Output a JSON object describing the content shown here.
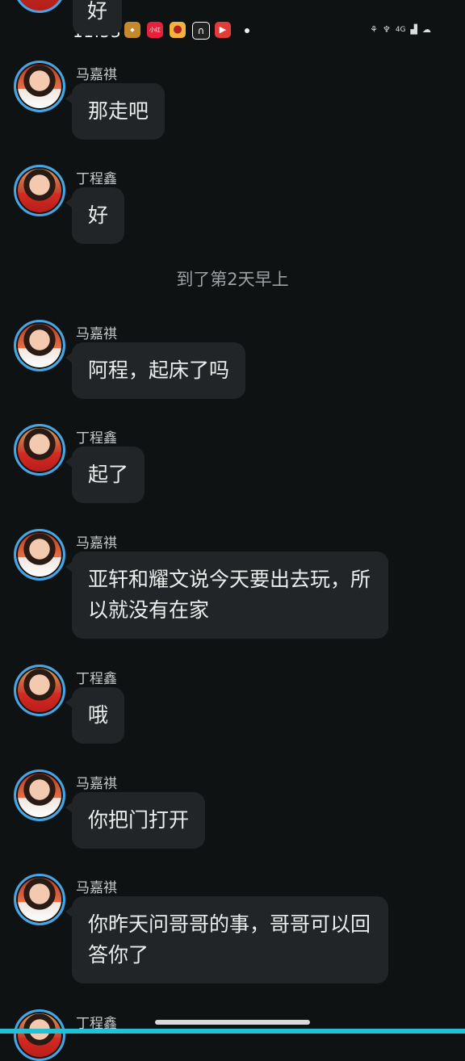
{
  "status_bar": {
    "time": "11:53",
    "app_icons": [
      {
        "name": "game-app-icon",
        "color": "#c4882d",
        "label": ""
      },
      {
        "name": "xiaohongshu-icon",
        "color": "#e8203a",
        "label": "小红书"
      },
      {
        "name": "weibo-icon",
        "color": "#f4b23e",
        "label": ""
      },
      {
        "name": "headset-app-icon",
        "color": "#222222",
        "label": ""
      },
      {
        "name": "video-app-icon",
        "color": "#e33b38",
        "label": ""
      }
    ],
    "right_indicators": [
      "4G"
    ]
  },
  "top_partial_message": {
    "text": "好"
  },
  "messages": [
    {
      "sender": "马嘉祺",
      "text": "那走吧",
      "avatar": "ma"
    },
    {
      "sender": "丁程鑫",
      "text": "好",
      "avatar": "ding"
    },
    {
      "sender": "马嘉祺",
      "text": "阿程，起床了吗",
      "avatar": "ma"
    },
    {
      "sender": "丁程鑫",
      "text": "起了",
      "avatar": "ding"
    },
    {
      "sender": "马嘉祺",
      "text": "亚轩和耀文说今天要出去玩，所以就没有在家",
      "avatar": "ma"
    },
    {
      "sender": "丁程鑫",
      "text": "哦",
      "avatar": "ding"
    },
    {
      "sender": "马嘉祺",
      "text": "你把门打开",
      "avatar": "ma"
    },
    {
      "sender": "马嘉祺",
      "text": "你昨天问哥哥的事，哥哥可以回答你了",
      "avatar": "ma"
    },
    {
      "sender": "丁程鑫",
      "text": "",
      "avatar": "ding"
    }
  ],
  "divider": {
    "text": "到了第2天早上"
  }
}
